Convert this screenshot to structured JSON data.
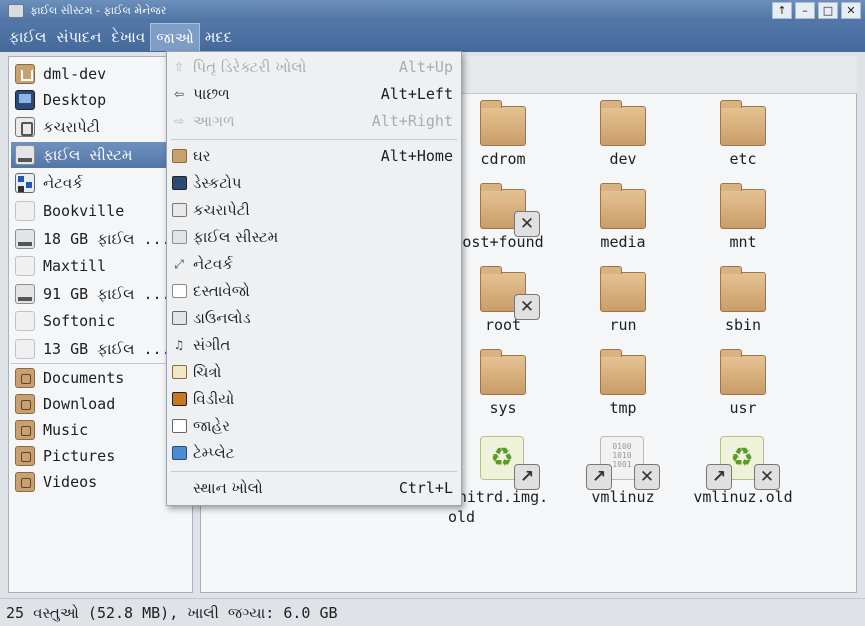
{
  "window": {
    "title": "ફાઈલ સીસ્ટમ - ફાઈલ મેનેજર",
    "controls": [
      "↑",
      "–",
      "□",
      "✕"
    ]
  },
  "menubar": [
    "ફાઈલ",
    "સંપાદન",
    "દેખાવ",
    "જાઓ",
    "મદદ"
  ],
  "sidebar": {
    "items": [
      {
        "label": "dml-dev",
        "icon": "home-folder-icon"
      },
      {
        "label": "Desktop",
        "icon": "desktop-icon"
      },
      {
        "label": "કચરાપેટી",
        "icon": "trash-icon"
      },
      {
        "label": "ફાઈલ સીસ્ટમ",
        "icon": "drive-icon"
      },
      {
        "label": "નેટવર્ક",
        "icon": "network-icon"
      },
      {
        "label": "Bookville",
        "icon": "disk-icon"
      },
      {
        "label": "18 GB ફાઈલ ...",
        "icon": "drive-icon"
      },
      {
        "label": "Maxtill",
        "icon": "disk-icon"
      },
      {
        "label": "91 GB ફાઈલ ...",
        "icon": "drive-icon"
      },
      {
        "label": "Softonic",
        "icon": "disk-icon"
      },
      {
        "label": "13 GB ફાઈલ ...",
        "icon": "disk-icon"
      },
      {
        "label": "Documents",
        "icon": "documents-folder-icon"
      },
      {
        "label": "Download",
        "icon": "download-folder-icon"
      },
      {
        "label": "Music",
        "icon": "music-folder-icon"
      },
      {
        "label": "Pictures",
        "icon": "pictures-folder-icon"
      },
      {
        "label": "Videos",
        "icon": "videos-folder-icon"
      }
    ]
  },
  "go_menu": {
    "items": [
      {
        "label": "પિતૃ ડિરેક્ટરી ખોલો",
        "accel": "Alt+Up",
        "enabled": false,
        "icon": "up-arrow-icon"
      },
      {
        "label": "પાછળ",
        "accel": "Alt+Left",
        "enabled": true,
        "icon": "back-arrow-icon"
      },
      {
        "label": "આગળ",
        "accel": "Alt+Right",
        "enabled": false,
        "icon": "forward-arrow-icon"
      },
      {
        "label": "ઘર",
        "accel": "Alt+Home",
        "enabled": true,
        "icon": "home-icon"
      },
      {
        "label": "ડેસ્કટોપ",
        "accel": "",
        "enabled": true,
        "icon": "desktop-icon"
      },
      {
        "label": "કચરાપેટી",
        "accel": "",
        "enabled": true,
        "icon": "trash-icon"
      },
      {
        "label": "ફાઈલ સીસ્ટમ",
        "accel": "",
        "enabled": true,
        "icon": "drive-icon"
      },
      {
        "label": "નેટવર્ક",
        "accel": "",
        "enabled": true,
        "icon": "network-icon"
      },
      {
        "label": "દસ્તાવેજો",
        "accel": "",
        "enabled": true,
        "icon": "document-icon"
      },
      {
        "label": "ડાઉનલોડ",
        "accel": "",
        "enabled": true,
        "icon": "download-icon"
      },
      {
        "label": "સંગીત",
        "accel": "",
        "enabled": true,
        "icon": "music-icon"
      },
      {
        "label": "ચિત્રો",
        "accel": "",
        "enabled": true,
        "icon": "pictures-icon"
      },
      {
        "label": "વિડીયો",
        "accel": "",
        "enabled": true,
        "icon": "video-icon"
      },
      {
        "label": "જાહેર",
        "accel": "",
        "enabled": true,
        "icon": "share-icon"
      },
      {
        "label": "ટેમ્પ્લેટ",
        "accel": "",
        "enabled": true,
        "icon": "template-icon"
      },
      {
        "label": "સ્થાન ખોલો",
        "accel": "Ctrl+L",
        "enabled": true,
        "icon": ""
      }
    ]
  },
  "files": [
    {
      "name": "cdrom",
      "type": "folder"
    },
    {
      "name": "dev",
      "type": "folder"
    },
    {
      "name": "etc",
      "type": "folder"
    },
    {
      "name": "lost+found",
      "type": "folder-locked",
      "display": "ost+found"
    },
    {
      "name": "media",
      "type": "folder"
    },
    {
      "name": "mnt",
      "type": "folder"
    },
    {
      "name": "root",
      "type": "folder-locked"
    },
    {
      "name": "run",
      "type": "folder"
    },
    {
      "name": "sbin",
      "type": "folder"
    },
    {
      "name": "sys",
      "type": "folder"
    },
    {
      "name": "tmp",
      "type": "folder"
    },
    {
      "name": "usr",
      "type": "folder"
    },
    {
      "name": "initrd.img.old",
      "type": "link-archive",
      "display": "nitrd.img.",
      "display2": "old"
    },
    {
      "name": "vmlinuz",
      "type": "link-binary"
    },
    {
      "name": "vmlinuz.old",
      "type": "link-archive"
    }
  ],
  "status": "25 વસ્તુઓ (52.8 MB), ખાલી જગ્યા: 6.0 GB",
  "colors": {
    "titlebar": "#4f74a3",
    "selection": "#5476a7",
    "folder": "#c99d68"
  }
}
